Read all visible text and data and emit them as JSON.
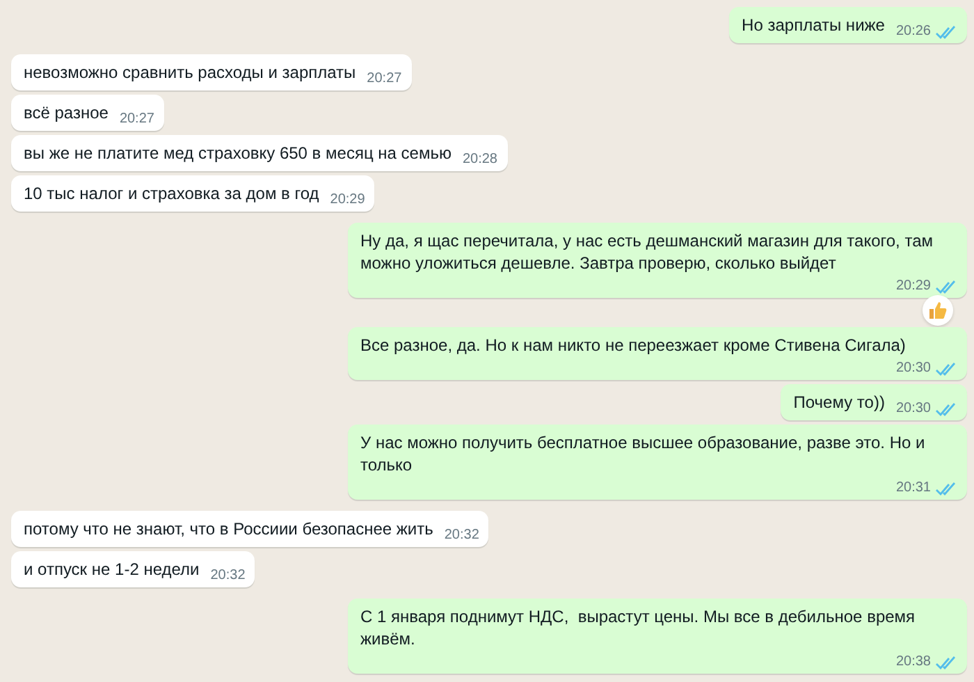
{
  "messages": [
    {
      "kind": "out",
      "text": "Но зарплаты ниже",
      "time": "20:26",
      "read": true,
      "reacted": false
    },
    {
      "kind": "in",
      "text": "невозможно сравнить расходы и зарплаты",
      "time": "20:27"
    },
    {
      "kind": "in",
      "text": "всё разное",
      "time": "20:27"
    },
    {
      "kind": "in",
      "text": "вы же не платите мед страховку 650 в месяц на семью",
      "time": "20:28"
    },
    {
      "kind": "in",
      "text": "10 тыс налог и страховка за дом в год",
      "time": "20:29"
    },
    {
      "kind": "out",
      "text": "Ну да, я щас перечитала, у нас есть дешманский магазин для такого, там можно уложиться дешевле. Завтра проверю, сколько выйдет",
      "time": "20:29",
      "read": true,
      "reacted": true
    },
    {
      "kind": "out",
      "text": "Все разное, да. Но к нам никто не переезжает кроме Стивена Сигала)",
      "time": "20:30",
      "read": true,
      "reacted": false
    },
    {
      "kind": "out",
      "text": "Почему то))",
      "time": "20:30",
      "read": true,
      "reacted": false
    },
    {
      "kind": "out",
      "text": "У нас можно получить бесплатное высшее образование, разве это. Но и только",
      "time": "20:31",
      "read": true,
      "reacted": false
    },
    {
      "kind": "in",
      "text": "потому что не знают, что в Россиии безопаснее жить",
      "time": "20:32"
    },
    {
      "kind": "in",
      "text": "и отпуск не 1-2 недели",
      "time": "20:32"
    },
    {
      "kind": "out",
      "text": "С 1 января поднимут НДС,  вырастут цены. Мы все в дебильное время живём.",
      "time": "20:38",
      "read": true,
      "reacted": false
    }
  ]
}
